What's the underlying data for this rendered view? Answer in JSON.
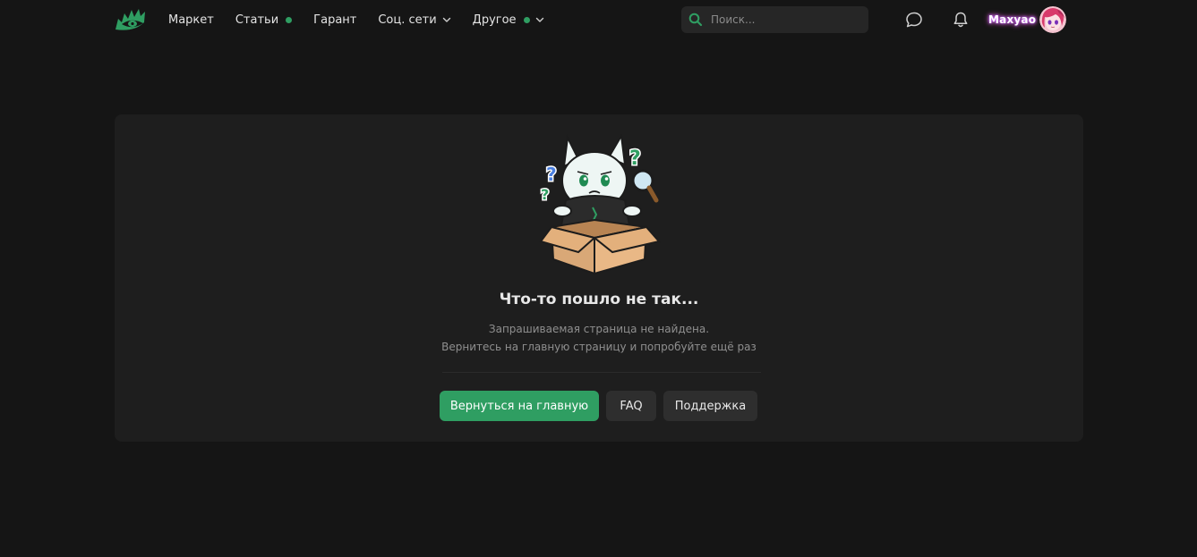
{
  "header": {
    "nav": [
      {
        "label": "Маркет",
        "dot": false,
        "dropdown": false
      },
      {
        "label": "Статьи",
        "dot": true,
        "dropdown": false
      },
      {
        "label": "Гарант",
        "dot": false,
        "dropdown": false
      },
      {
        "label": "Соц. сети",
        "dot": false,
        "dropdown": true
      },
      {
        "label": "Другое",
        "dot": true,
        "dropdown": true
      }
    ],
    "search": {
      "placeholder": "Поиск..."
    },
    "icons": [
      "chat-icon",
      "bell-icon"
    ],
    "user": {
      "name": "Maxyao"
    }
  },
  "error": {
    "title": "Что-то пошло не так...",
    "line1": "Запрашиваемая страница не найдена.",
    "line2": "Вернитесь на главную страницу и попробуйте ещё раз"
  },
  "actions": {
    "home_label": "Вернуться на главную",
    "faq_label": "FAQ",
    "support_label": "Поддержка"
  },
  "colors": {
    "background": "#151515",
    "card": "#1e1e1e",
    "accent": "#2f9e62",
    "button": "#2e2e2e"
  }
}
